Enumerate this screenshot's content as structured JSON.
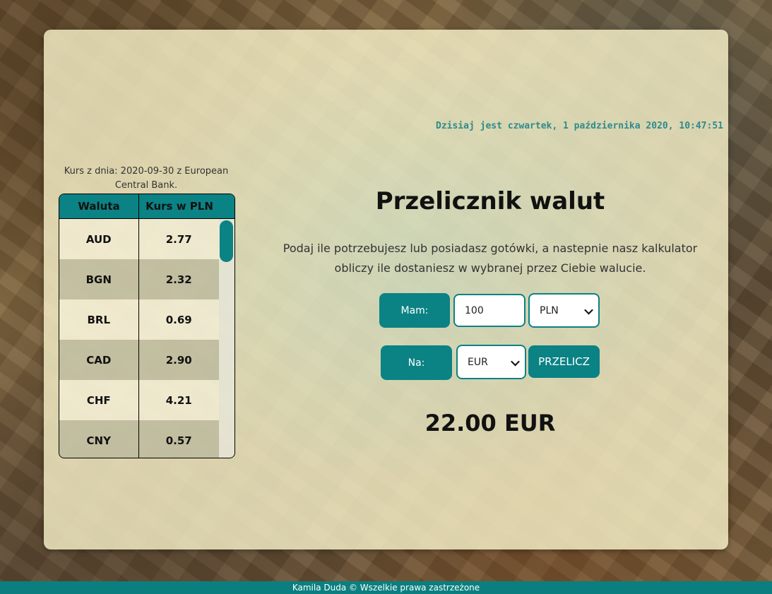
{
  "header": {
    "date_text": "Dzisiaj jest czwartek, 1 października 2020, 10:47:51"
  },
  "rates": {
    "info": "Kurs z dnia: 2020-09-30 z European Central Bank.",
    "columns": [
      "Waluta",
      "Kurs w PLN"
    ],
    "rows": [
      {
        "currency": "AUD",
        "rate": "2.77"
      },
      {
        "currency": "BGN",
        "rate": "2.32"
      },
      {
        "currency": "BRL",
        "rate": "0.69"
      },
      {
        "currency": "CAD",
        "rate": "2.90"
      },
      {
        "currency": "CHF",
        "rate": "4.21"
      },
      {
        "currency": "CNY",
        "rate": "0.57"
      }
    ]
  },
  "converter": {
    "title": "Przelicznik walut",
    "description": "Podaj ile potrzebujesz lub posiadasz gotówki, a nastepnie nasz kalkulator obliczy ile dostaniesz w wybranej przez Ciebie walucie.",
    "have_label": "Mam:",
    "amount_value": "100",
    "from_currency": "PLN",
    "to_label": "Na:",
    "to_currency": "EUR",
    "convert_button": "PRZELICZ",
    "result": "22.00 EUR"
  },
  "footer": {
    "text": "Kamila Duda © Wszelkie prawa zastrzeżone"
  },
  "colors": {
    "accent": "#0b8284",
    "date_text": "#2e8b8b"
  }
}
